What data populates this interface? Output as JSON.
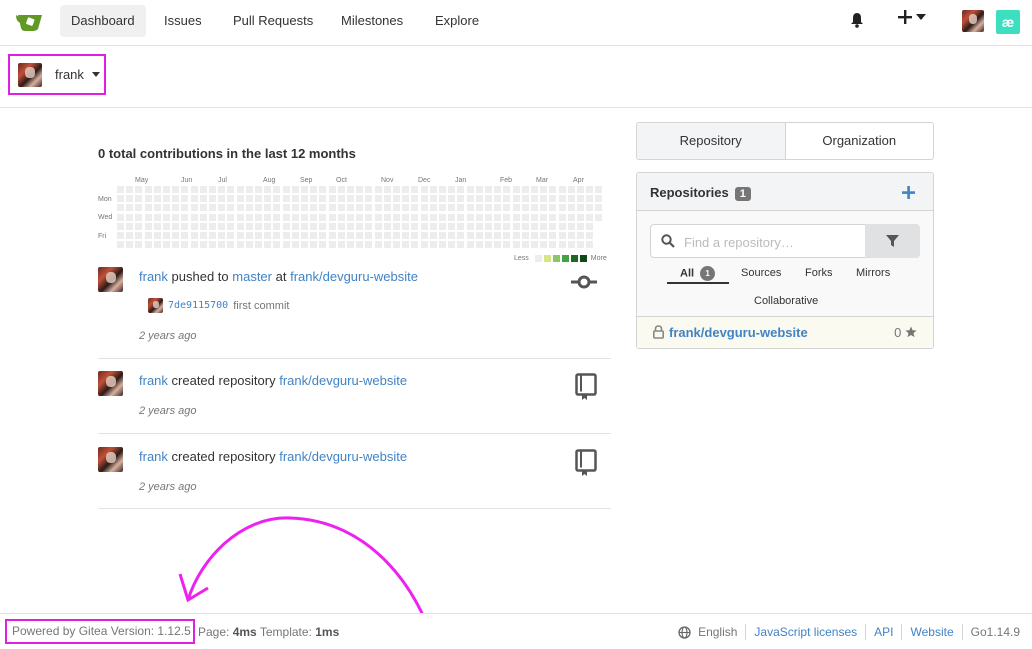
{
  "nav": {
    "items": [
      {
        "label": "Dashboard",
        "active": true
      },
      {
        "label": "Issues"
      },
      {
        "label": "Pull Requests"
      },
      {
        "label": "Milestones"
      },
      {
        "label": "Explore"
      }
    ],
    "notifications_icon": "bell-icon",
    "create_icon": "plus-icon",
    "app_icon_label": "æ"
  },
  "context": {
    "user": "frank"
  },
  "contributions": {
    "title": "0 total contributions in the last 12 months",
    "months": [
      "May",
      "Jun",
      "Jul",
      "Aug",
      "Sep",
      "Oct",
      "Nov",
      "Dec",
      "Jan",
      "Feb",
      "Mar",
      "Apr"
    ],
    "days": [
      "Mon",
      "Wed",
      "Fri"
    ],
    "legend_less": "Less",
    "legend_more": "More",
    "legend_colors": [
      "#ededed",
      "#d6e685",
      "#8cc665",
      "#44a340",
      "#1e6823",
      "#0e4a12"
    ]
  },
  "feed": [
    {
      "user": "frank",
      "action": "pushed to",
      "branch": "master",
      "at": "at",
      "repo": "frank/devguru-website",
      "commit_sha": "7de9115700",
      "commit_msg": "first commit",
      "time": "2 years ago",
      "icon": "git-commit-icon"
    },
    {
      "user": "frank",
      "action": "created repository",
      "repo": "frank/devguru-website",
      "time": "2 years ago",
      "icon": "repo-icon"
    },
    {
      "user": "frank",
      "action": "created repository",
      "repo": "frank/devguru-website",
      "time": "2 years ago",
      "icon": "repo-icon"
    }
  ],
  "side": {
    "tabs": [
      "Repository",
      "Organization"
    ],
    "repos_title": "Repositories",
    "repos_count": "1",
    "search_placeholder": "Find a repository…",
    "filters": {
      "all": "All",
      "all_count": "1",
      "sources": "Sources",
      "forks": "Forks",
      "mirrors": "Mirrors",
      "collaborative": "Collaborative"
    },
    "repo": {
      "name": "frank/devguru-website",
      "stars": "0"
    }
  },
  "footer": {
    "powered": "Powered by Gitea Version: 1.12.5",
    "page_label": "Page:",
    "page_time": "4ms",
    "template_label": "Template:",
    "template_time": "1ms",
    "language": "English",
    "links": [
      "JavaScript licenses",
      "API",
      "Website"
    ],
    "go_version": "Go1.14.9"
  },
  "colors": {
    "accent": "#4183c4",
    "annotation": "#e020e0",
    "gitea_green": "#609926"
  }
}
